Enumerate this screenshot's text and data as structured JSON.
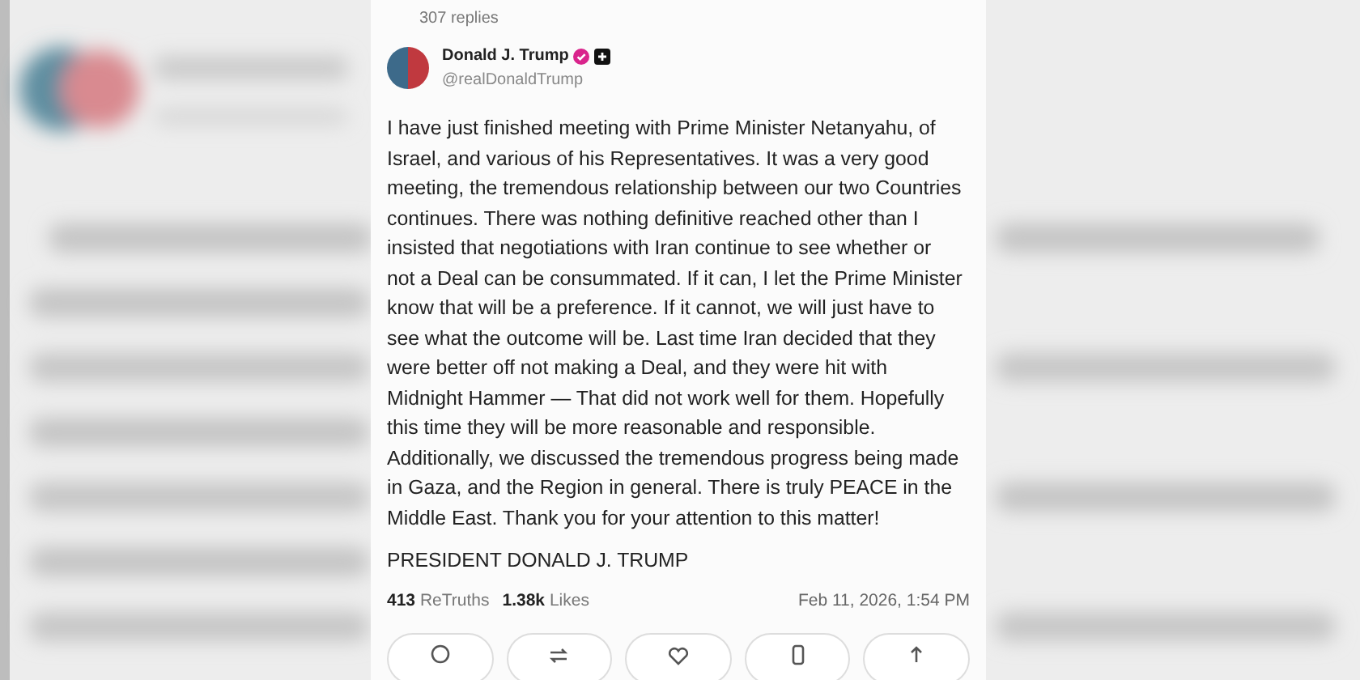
{
  "reply_count": "307 replies",
  "author": {
    "name": "Donald J. Trump",
    "handle": "@realDonaldTrump",
    "verified": true
  },
  "body": "I have just finished meeting with Prime Minister Netanyahu, of Israel, and various of his Representatives. It was a very good meeting, the tremendous relationship between our two Countries continues. There was nothing definitive reached other than I insisted that negotiations with Iran continue to see whether or not a Deal can be consummated. If it can, I let the Prime Minister know that will be a preference. If it cannot, we will just have to see what the outcome will be. Last time Iran decided that they were better off not making a Deal, and they were hit with Midnight Hammer — That did not work well for them. Hopefully this time they will be more reasonable and responsible. Additionally, we discussed the tremendous progress being made in Gaza, and the Region in general. There is truly PEACE in the Middle East. Thank you for your attention to this matter!",
  "signature": "PRESIDENT DONALD J. TRUMP",
  "stats": [
    {
      "count": "413",
      "label": "ReTruths"
    },
    {
      "count": "1.38k",
      "label": "Likes"
    }
  ],
  "timestamp": "Feb 11, 2026, 1:54 PM",
  "actions": [
    {
      "kind": "reply"
    },
    {
      "kind": "retruth"
    },
    {
      "kind": "like"
    },
    {
      "kind": "bookmark"
    },
    {
      "kind": "share"
    }
  ]
}
